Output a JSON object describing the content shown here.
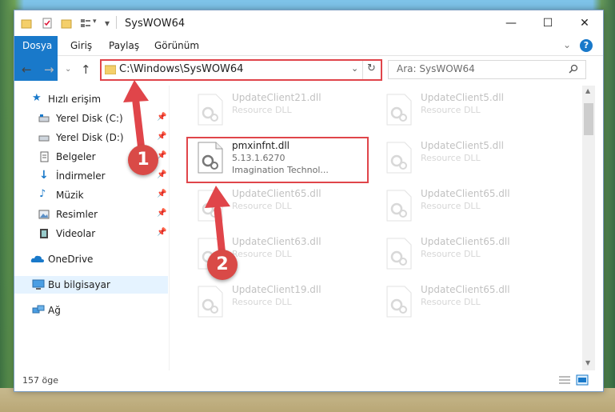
{
  "window": {
    "title": "SysWOW64",
    "controls": {
      "minimize": "—",
      "maximize": "☐",
      "close": "✕"
    }
  },
  "ribbon": {
    "tabs": [
      "Dosya",
      "Giriş",
      "Paylaş",
      "Görünüm"
    ],
    "expand_icon": "chevron-down-icon",
    "help_icon": "help-icon",
    "help_glyph": "?"
  },
  "address": {
    "path": "C:\\Windows\\SysWOW64",
    "search_placeholder": "Ara: SysWOW64"
  },
  "nav": {
    "items": [
      {
        "label": "Hızlı erişim",
        "icon": "star-icon",
        "pinned": false
      },
      {
        "label": "Yerel Disk (C:)",
        "icon": "drive-icon",
        "pinned": true
      },
      {
        "label": "Yerel Disk (D:)",
        "icon": "drive-icon",
        "pinned": true
      },
      {
        "label": "Belgeler",
        "icon": "documents-icon",
        "pinned": true
      },
      {
        "label": "İndirmeler",
        "icon": "download-icon",
        "pinned": true
      },
      {
        "label": "Müzik",
        "icon": "music-icon",
        "pinned": true
      },
      {
        "label": "Resimler",
        "icon": "pictures-icon",
        "pinned": true
      },
      {
        "label": "Videolar",
        "icon": "video-icon",
        "pinned": true
      },
      {
        "label": "OneDrive",
        "icon": "cloud-icon",
        "pinned": false
      },
      {
        "label": "Bu bilgisayar",
        "icon": "computer-icon",
        "pinned": false,
        "selected": true
      },
      {
        "label": "Ağ",
        "icon": "network-icon",
        "pinned": false
      }
    ]
  },
  "files": {
    "left": [
      {
        "name": "UpdateClient21.dll",
        "desc": "Resource DLL",
        "company": "",
        "faded": true
      },
      {
        "name": "pmxinfnt.dll",
        "desc": "5.13.1.6270",
        "company": "Imagination Technol...",
        "faded": false
      },
      {
        "name": "UpdateClient65.dll",
        "desc": "Resource DLL",
        "company": "",
        "faded": true
      },
      {
        "name": "UpdateClient63.dll",
        "desc": "Resource DLL",
        "company": "",
        "faded": true
      },
      {
        "name": "UpdateClient19.dll",
        "desc": "Resource DLL",
        "company": "",
        "faded": true
      }
    ],
    "right": [
      {
        "name": "UpdateClient5.dll",
        "desc": "Resource DLL",
        "faded": true
      },
      {
        "name": "UpdateClient5.dll",
        "desc": "Resource DLL",
        "faded": true
      },
      {
        "name": "UpdateClient65.dll",
        "desc": "Resource DLL",
        "faded": true
      },
      {
        "name": "UpdateClient65.dll",
        "desc": "Resource DLL",
        "faded": true
      },
      {
        "name": "UpdateClient65.dll",
        "desc": "Resource DLL",
        "faded": true
      }
    ]
  },
  "status": {
    "count": "157 öge"
  },
  "annotations": {
    "step1": "1",
    "step2": "2",
    "color": "#d94a47"
  }
}
